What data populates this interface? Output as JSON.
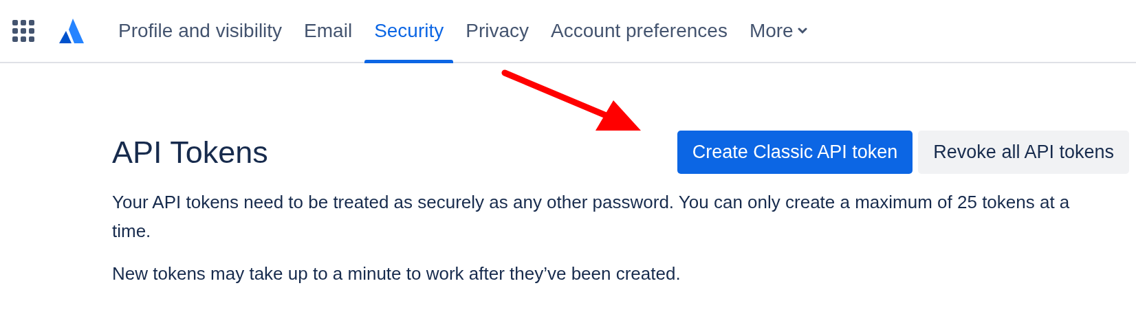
{
  "tabs": [
    {
      "label": "Profile and visibility",
      "selected": false,
      "has_menu": false
    },
    {
      "label": "Email",
      "selected": false,
      "has_menu": false
    },
    {
      "label": "Security",
      "selected": true,
      "has_menu": false
    },
    {
      "label": "Privacy",
      "selected": false,
      "has_menu": false
    },
    {
      "label": "Account preferences",
      "selected": false,
      "has_menu": false
    },
    {
      "label": "More",
      "selected": false,
      "has_menu": true
    }
  ],
  "title": "API Tokens",
  "buttons": [
    {
      "label": "Create Classic API token",
      "kind": "primary"
    },
    {
      "label": "Revoke all API tokens",
      "kind": "secondary"
    }
  ],
  "paragraphs": [
    "Your API tokens need to be treated as securely as any other password. You can only create a maximum of 25 tokens at a time.",
    "New tokens may take up to a minute to work after they’ve been created."
  ]
}
